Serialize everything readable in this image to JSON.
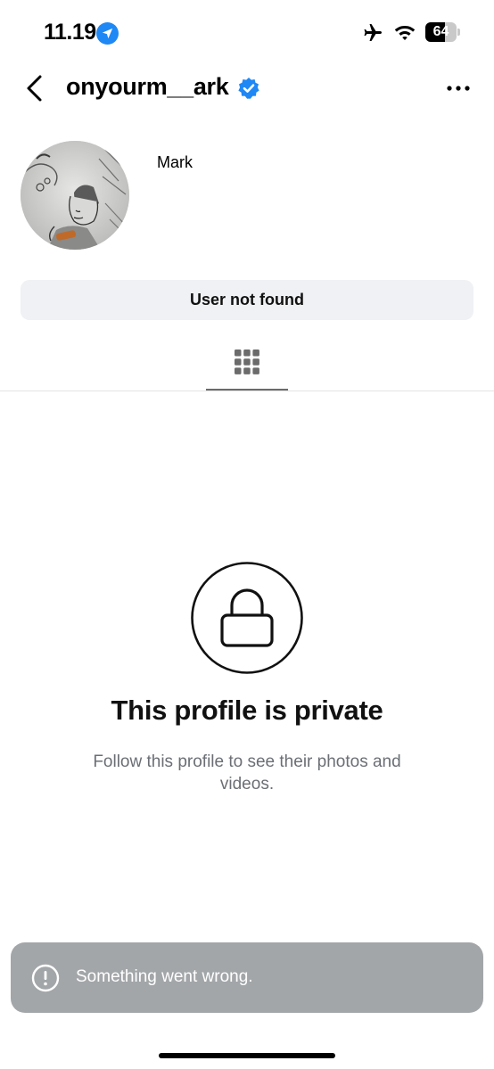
{
  "status_bar": {
    "time": "11.19",
    "battery_level": "64",
    "battery_fraction": 0.64,
    "icons": [
      "location-arrow-icon",
      "airplane-icon",
      "wifi-icon",
      "battery-icon"
    ]
  },
  "header": {
    "username": "onyourm__ark",
    "verified": true,
    "icons": [
      "back-chevron-icon",
      "verified-badge-icon",
      "more-options-icon"
    ]
  },
  "profile": {
    "display_name": "Mark",
    "action_button_label": "User not found"
  },
  "tabs": {
    "active": "grid",
    "icons": [
      "grid-icon"
    ]
  },
  "private_notice": {
    "title": "This profile is private",
    "subtitle": "Follow this profile to see their photos and videos.",
    "icon": "lock-icon"
  },
  "toast": {
    "message": "Something went wrong.",
    "icon": "exclamation-circle-icon"
  },
  "colors": {
    "verified_blue": "#1e88f5",
    "toast_bg": "#a3a6a9",
    "button_bg": "#eff1f4",
    "subtitle_gray": "#6b6f75"
  }
}
